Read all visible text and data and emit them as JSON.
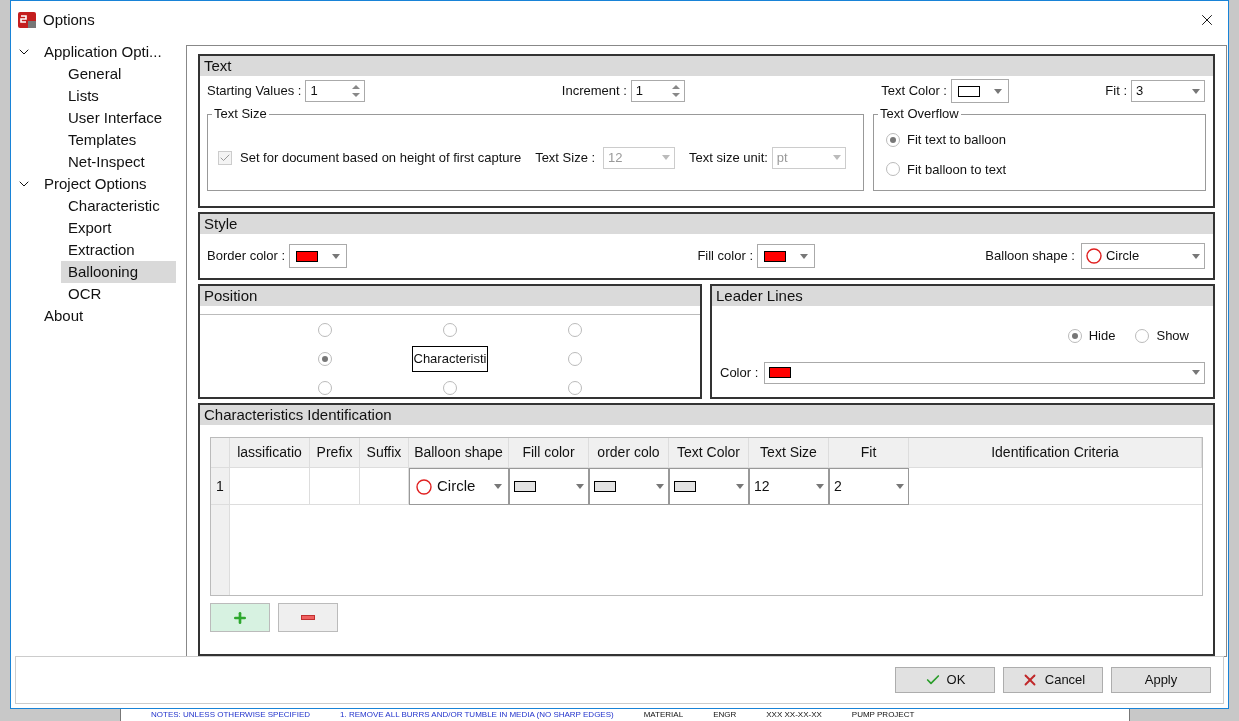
{
  "window": {
    "title": "Options"
  },
  "sidebar": {
    "items": [
      {
        "label": "Application Opti...",
        "expanded": true,
        "selected": false,
        "children": [
          {
            "label": "General",
            "selected": false
          },
          {
            "label": "Lists",
            "selected": false
          },
          {
            "label": "User Interface",
            "selected": false
          },
          {
            "label": "Templates",
            "selected": false
          },
          {
            "label": "Net-Inspect",
            "selected": false
          }
        ]
      },
      {
        "label": "Project Options",
        "expanded": true,
        "selected": false,
        "children": [
          {
            "label": "Characteristic",
            "selected": false
          },
          {
            "label": "Export",
            "selected": false
          },
          {
            "label": "Extraction",
            "selected": false
          },
          {
            "label": "Ballooning",
            "selected": true
          },
          {
            "label": "OCR",
            "selected": false
          }
        ]
      },
      {
        "label": "About",
        "selected": false
      }
    ]
  },
  "text_section": {
    "title": "Text",
    "starting_values": {
      "label": "Starting Values :",
      "value": "1"
    },
    "increment": {
      "label": "Increment :",
      "value": "1"
    },
    "text_color": {
      "label": "Text Color :",
      "color": "#ffffff"
    },
    "fit": {
      "label": "Fit :",
      "value": "3"
    },
    "text_size_group": {
      "title": "Text Size",
      "checkbox": {
        "label": "Set for document based on height of first capture",
        "checked": true,
        "disabled": true
      },
      "text_size": {
        "label": "Text Size :",
        "value": "12",
        "disabled": true
      },
      "unit": {
        "label": "Text size unit:",
        "value": "pt",
        "disabled": true
      }
    },
    "overflow": {
      "title": "Text Overflow",
      "options": [
        {
          "label": "Fit text to balloon",
          "selected": true
        },
        {
          "label": "Fit balloon to text",
          "selected": false
        }
      ]
    }
  },
  "style": {
    "title": "Style",
    "border_color": {
      "label": "Border color :",
      "color": "#ff0000"
    },
    "fill_color": {
      "label": "Fill color :",
      "color": "#ff0000"
    },
    "balloon_shape": {
      "label": "Balloon shape :",
      "value": "Circle"
    }
  },
  "position": {
    "title": "Position",
    "center_label": "Characteristi",
    "options": [
      {
        "selected": false
      },
      {
        "selected": false
      },
      {
        "selected": false
      },
      {
        "selected": true
      },
      {
        "selected": false
      },
      {
        "selected": false
      },
      {
        "selected": false
      },
      {
        "selected": false
      }
    ]
  },
  "leader_lines": {
    "title": "Leader Lines",
    "options": [
      {
        "label": "Hide",
        "selected": true
      },
      {
        "label": "Show",
        "selected": false
      }
    ],
    "color": {
      "label": "Color :",
      "color": "#ff0000"
    }
  },
  "characteristics": {
    "title": "Characteristics Identification",
    "columns": [
      "lassificatio",
      "Prefix",
      "Suffix",
      "Balloon shape",
      "Fill color",
      "order colo",
      "Text Color",
      "Text Size",
      "Fit",
      "Identification Criteria"
    ],
    "rows": [
      {
        "row_header": "1",
        "balloon_shape": "Circle",
        "text_size": "12",
        "fit": "2"
      }
    ]
  },
  "buttons": [
    {
      "label": "OK",
      "kind": "ok"
    },
    {
      "label": "Cancel",
      "kind": "cancel"
    },
    {
      "label": "Apply",
      "kind": "apply"
    }
  ],
  "background": {
    "texts": [
      "NOTES:  UNLESS OTHERWISE SPECIFIED",
      "1. REMOVE ALL BURRS AND/OR TUMBLE IN MEDIA (NO SHARP EDGES)",
      "MATERIAL",
      "ENGR",
      "XXX  XX-XX-XX",
      "PUMP PROJECT"
    ]
  }
}
